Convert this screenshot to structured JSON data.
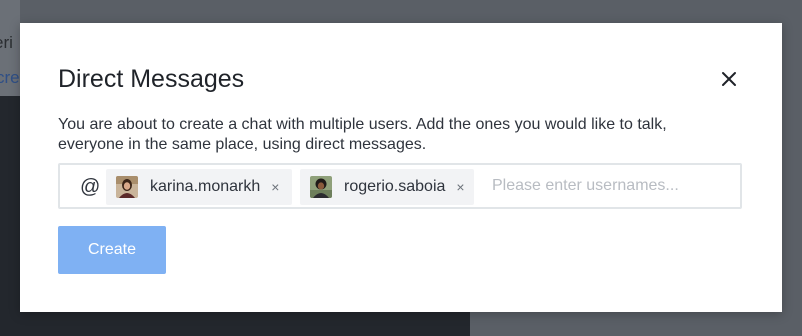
{
  "background": {
    "text_1": "eri",
    "text_2": "cre"
  },
  "modal": {
    "title": "Direct Messages",
    "close_icon": "close-icon",
    "description": "You are about to create a chat with multiple users. Add the ones you would like to talk, everyone in the same place, using direct messages.",
    "input": {
      "prefix": "@",
      "placeholder": "Please enter usernames...",
      "value": "",
      "selected_users": [
        {
          "username": "karina.monarkh",
          "remove": "×",
          "avatar": "avatar-photo"
        },
        {
          "username": "rogerio.saboia",
          "remove": "×",
          "avatar": "avatar-photo"
        }
      ]
    },
    "create_button": "Create"
  },
  "colors": {
    "primary_disabled": "#7fb1f3",
    "overlay": "#5a5f66"
  }
}
